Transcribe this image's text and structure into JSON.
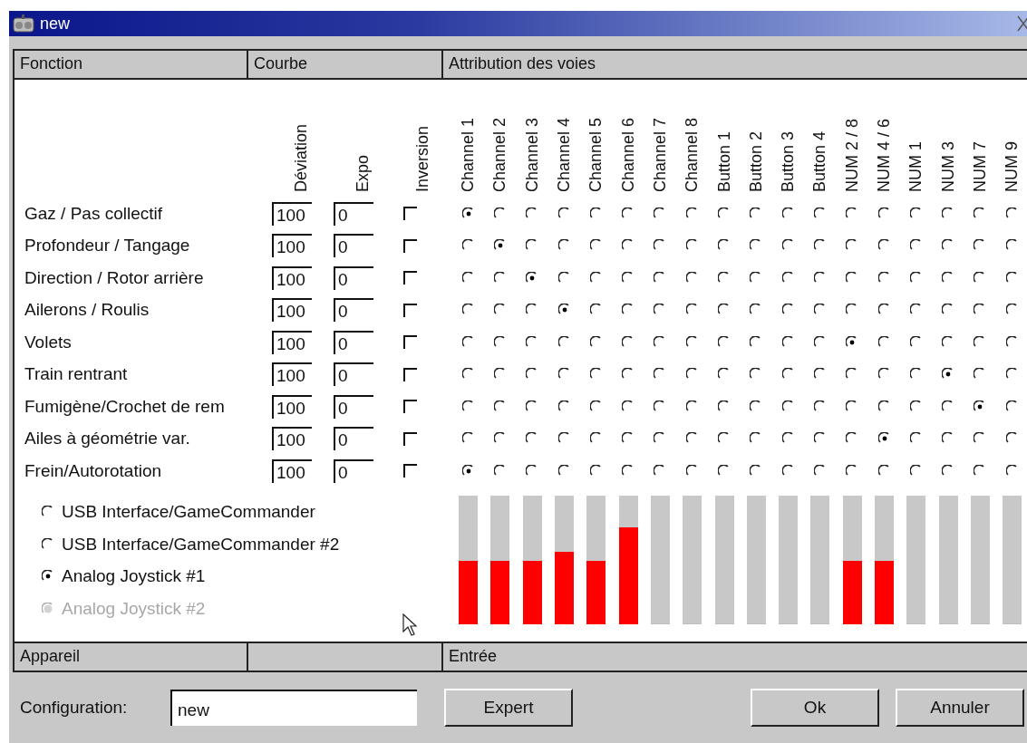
{
  "window": {
    "title": "new"
  },
  "headers": [
    "Fonction",
    "Courbe",
    "Attribution des voies"
  ],
  "curve_columns": [
    "Déviation",
    "Expo",
    "Inversion"
  ],
  "channels": [
    "Channel 1",
    "Channel 2",
    "Channel 3",
    "Channel 4",
    "Channel 5",
    "Channel 6",
    "Channel 7",
    "Channel 8",
    "Button 1",
    "Button 2",
    "Button 3",
    "Button 4",
    "NUM 2 / 8",
    "NUM 4 / 6",
    "NUM 1",
    "NUM 3",
    "NUM 7",
    "NUM 9"
  ],
  "functions": [
    {
      "label": "Gaz / Pas collectif",
      "deviation": "100",
      "expo": "0",
      "inverted": false,
      "assignment": [
        {
          "selected": true
        },
        {
          "selected": false
        },
        {
          "selected": false
        },
        {
          "selected": false
        },
        {
          "selected": false
        },
        {
          "selected": false
        },
        {
          "selected": false
        },
        {
          "selected": false
        },
        {
          "selected": false
        },
        {
          "selected": false
        },
        {
          "selected": false
        },
        {
          "selected": false
        },
        {
          "selected": false
        },
        {
          "selected": false
        },
        {
          "selected": false
        },
        {
          "selected": false
        },
        {
          "selected": false
        },
        {
          "selected": false
        }
      ]
    },
    {
      "label": "Profondeur / Tangage",
      "deviation": "100",
      "expo": "0",
      "inverted": false,
      "assignment": [
        {
          "selected": false
        },
        {
          "selected": true
        },
        {
          "selected": false
        },
        {
          "selected": false
        },
        {
          "selected": false
        },
        {
          "selected": false
        },
        {
          "selected": false
        },
        {
          "selected": false
        },
        {
          "selected": false
        },
        {
          "selected": false
        },
        {
          "selected": false
        },
        {
          "selected": false
        },
        {
          "selected": false
        },
        {
          "selected": false
        },
        {
          "selected": false
        },
        {
          "selected": false
        },
        {
          "selected": false
        },
        {
          "selected": false
        }
      ]
    },
    {
      "label": "Direction / Rotor arrière",
      "deviation": "100",
      "expo": "0",
      "inverted": false,
      "assignment": [
        {
          "selected": false
        },
        {
          "selected": false
        },
        {
          "selected": true
        },
        {
          "selected": false
        },
        {
          "selected": false
        },
        {
          "selected": false
        },
        {
          "selected": false
        },
        {
          "selected": false
        },
        {
          "selected": false
        },
        {
          "selected": false
        },
        {
          "selected": false
        },
        {
          "selected": false
        },
        {
          "selected": false
        },
        {
          "selected": false
        },
        {
          "selected": false
        },
        {
          "selected": false
        },
        {
          "selected": false
        },
        {
          "selected": false
        }
      ]
    },
    {
      "label": "Ailerons / Roulis",
      "deviation": "100",
      "expo": "0",
      "inverted": false,
      "assignment": [
        {
          "selected": false
        },
        {
          "selected": false
        },
        {
          "selected": false
        },
        {
          "selected": true
        },
        {
          "selected": false
        },
        {
          "selected": false
        },
        {
          "selected": false
        },
        {
          "selected": false
        },
        {
          "selected": false
        },
        {
          "selected": false
        },
        {
          "selected": false
        },
        {
          "selected": false
        },
        {
          "selected": false
        },
        {
          "selected": false
        },
        {
          "selected": false
        },
        {
          "selected": false
        },
        {
          "selected": false
        },
        {
          "selected": false
        }
      ]
    },
    {
      "label": "Volets",
      "deviation": "100",
      "expo": "0",
      "inverted": false,
      "assignment": [
        {
          "selected": false
        },
        {
          "selected": false
        },
        {
          "selected": false
        },
        {
          "selected": false
        },
        {
          "selected": false
        },
        {
          "selected": false
        },
        {
          "selected": false
        },
        {
          "selected": false
        },
        {
          "selected": false
        },
        {
          "selected": false
        },
        {
          "selected": false
        },
        {
          "selected": false
        },
        {
          "selected": true
        },
        {
          "selected": false
        },
        {
          "selected": false
        },
        {
          "selected": false
        },
        {
          "selected": false
        },
        {
          "selected": false
        }
      ]
    },
    {
      "label": "Train rentrant",
      "deviation": "100",
      "expo": "0",
      "inverted": false,
      "assignment": [
        {
          "selected": false
        },
        {
          "selected": false
        },
        {
          "selected": false
        },
        {
          "selected": false
        },
        {
          "selected": false
        },
        {
          "selected": false
        },
        {
          "selected": false
        },
        {
          "selected": false
        },
        {
          "selected": false
        },
        {
          "selected": false
        },
        {
          "selected": false
        },
        {
          "selected": false
        },
        {
          "selected": false
        },
        {
          "selected": false
        },
        {
          "selected": false
        },
        {
          "selected": true
        },
        {
          "selected": false
        },
        {
          "selected": false
        }
      ]
    },
    {
      "label": "Fumigène/Crochet de rem",
      "deviation": "100",
      "expo": "0",
      "inverted": false,
      "assignment": [
        {
          "selected": false
        },
        {
          "selected": false
        },
        {
          "selected": false
        },
        {
          "selected": false
        },
        {
          "selected": false
        },
        {
          "selected": false
        },
        {
          "selected": false
        },
        {
          "selected": false
        },
        {
          "selected": false
        },
        {
          "selected": false
        },
        {
          "selected": false
        },
        {
          "selected": false
        },
        {
          "selected": false
        },
        {
          "selected": false
        },
        {
          "selected": false
        },
        {
          "selected": false
        },
        {
          "selected": true
        },
        {
          "selected": false
        }
      ]
    },
    {
      "label": "Ailes à géométrie var.",
      "deviation": "100",
      "expo": "0",
      "inverted": false,
      "assignment": [
        {
          "selected": false
        },
        {
          "selected": false
        },
        {
          "selected": false
        },
        {
          "selected": false
        },
        {
          "selected": false
        },
        {
          "selected": false
        },
        {
          "selected": false
        },
        {
          "selected": false
        },
        {
          "selected": false
        },
        {
          "selected": false
        },
        {
          "selected": false
        },
        {
          "selected": false
        },
        {
          "selected": false
        },
        {
          "selected": true
        },
        {
          "selected": false
        },
        {
          "selected": false
        },
        {
          "selected": false
        },
        {
          "selected": false
        }
      ]
    },
    {
      "label": "Frein/Autorotation",
      "deviation": "100",
      "expo": "0",
      "inverted": false,
      "assignment": [
        {
          "selected": true
        },
        {
          "selected": false
        },
        {
          "selected": false
        },
        {
          "selected": false
        },
        {
          "selected": false
        },
        {
          "selected": false
        },
        {
          "selected": false
        },
        {
          "selected": false
        },
        {
          "selected": false
        },
        {
          "selected": false
        },
        {
          "selected": false
        },
        {
          "selected": false
        },
        {
          "selected": false
        },
        {
          "selected": false
        },
        {
          "selected": false
        },
        {
          "selected": false
        },
        {
          "selected": false
        },
        {
          "selected": false
        }
      ]
    }
  ],
  "devices": [
    {
      "label": "USB Interface/GameCommander",
      "selected": false,
      "disabled": false
    },
    {
      "label": "USB Interface/GameCommander #2",
      "selected": false,
      "disabled": false
    },
    {
      "label": "Analog Joystick #1",
      "selected": true,
      "disabled": false
    },
    {
      "label": "Analog Joystick #2",
      "selected": false,
      "disabled": true
    }
  ],
  "inputs": [
    {
      "level": 0.49
    },
    {
      "level": 0.49
    },
    {
      "level": 0.49
    },
    {
      "level": 0.56
    },
    {
      "level": 0.49
    },
    {
      "level": 0.75
    },
    {
      "level": 0
    },
    {
      "level": 0
    },
    {
      "level": 0
    },
    {
      "level": 0
    },
    {
      "level": 0
    },
    {
      "level": 0
    },
    {
      "level": 0.49
    },
    {
      "level": 0.49
    },
    {
      "level": 0
    },
    {
      "level": 0
    },
    {
      "level": 0
    },
    {
      "level": 0
    }
  ],
  "footer_headers": {
    "device": "Appareil",
    "input": "Entrée"
  },
  "configuration": {
    "label": "Configuration:",
    "value": "new"
  },
  "buttons": [
    {
      "label": "Expert"
    },
    {
      "label": "Ok"
    },
    {
      "label": "Annuler"
    }
  ]
}
